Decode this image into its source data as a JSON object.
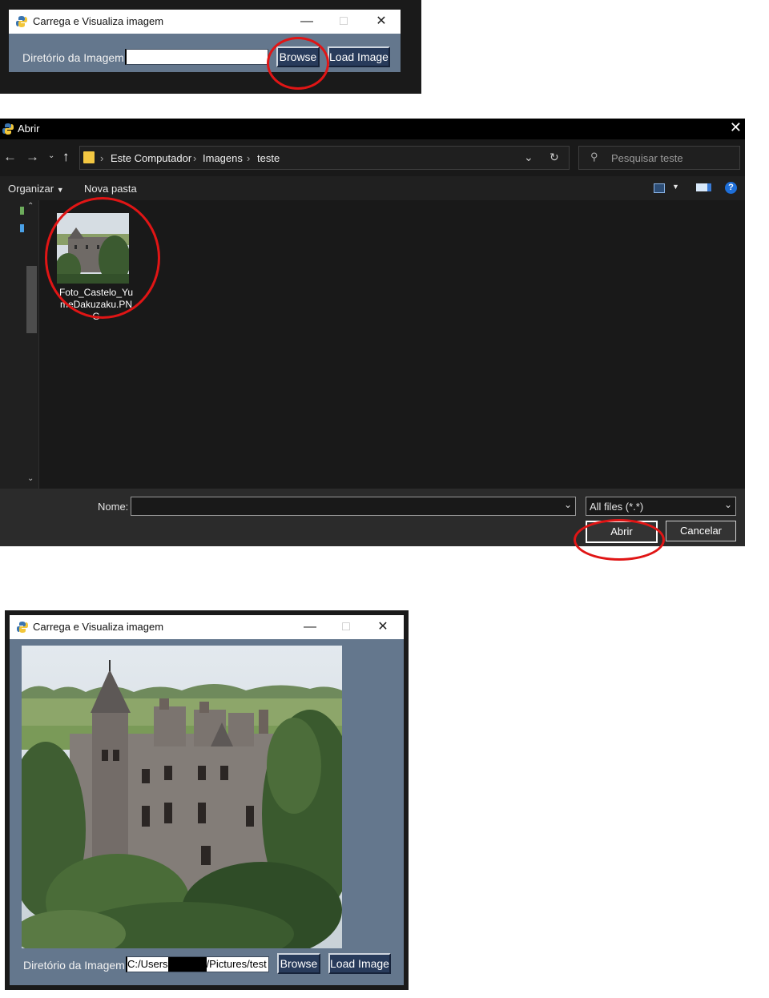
{
  "window1": {
    "title": "Carrega e Visualiza imagem",
    "minimize_icon": "minimize-icon",
    "maximize_icon": "maximize-icon",
    "close_icon": "close-icon",
    "label": "Diretório da Imagem",
    "path_value": "",
    "browse_label": "Browse",
    "load_label": "Load Image"
  },
  "dialog": {
    "title": "Abrir",
    "breadcrumb": [
      "Este Computador",
      "Imagens",
      "teste"
    ],
    "search_placeholder": "Pesquisar teste",
    "toolbar": {
      "organize": "Organizar",
      "new_folder": "Nova pasta"
    },
    "file": {
      "name": "Foto_Castelo_YumeDakuzaku.PNG",
      "name_lines": [
        "Foto_Castelo_Yu",
        "meDakuzaku.PN",
        "G"
      ]
    },
    "name_label": "Nome:",
    "name_value": "",
    "filetype": "All files (*.*)",
    "open_label": "Abrir",
    "cancel_label": "Cancelar"
  },
  "window2": {
    "title": "Carrega e Visualiza imagem",
    "label": "Diretório da Imagem",
    "path_prefix": "C:/Users",
    "path_suffix": "/Pictures/test",
    "browse_label": "Browse",
    "load_label": "Load Image"
  },
  "colors": {
    "tk_background": "#64778d",
    "tk_button": "#283b5b",
    "annotation": "#e01515",
    "dialog_background": "#191919"
  }
}
